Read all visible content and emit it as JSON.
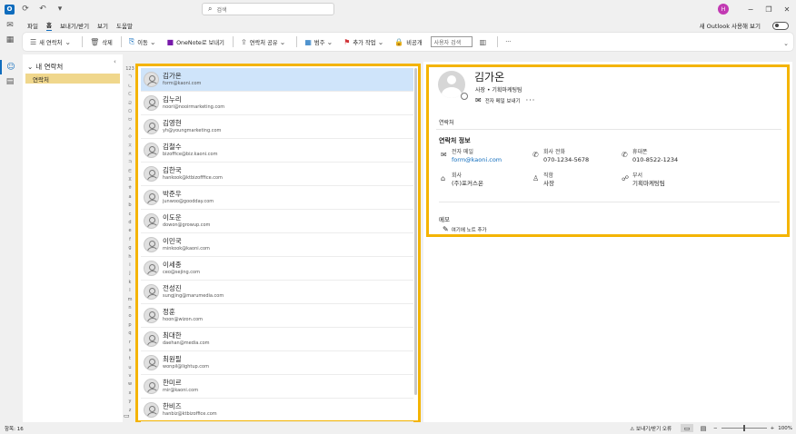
{
  "titlebar": {
    "search_placeholder": "검색",
    "avatar_initial": "H"
  },
  "menu": {
    "items": [
      "파일",
      "홈",
      "보내기/받기",
      "보기",
      "도움말"
    ],
    "active": 1,
    "new_outlook_label": "새 Outlook 사용해 보기"
  },
  "ribbon": {
    "new_contact": "새 연락처",
    "delete": "삭제",
    "move": "이동",
    "onenote": "OneNote로 보내기",
    "share_contact": "연락처 공유",
    "categorize": "범주",
    "follow_up": "추가 작업",
    "private": "비공개",
    "search_people_placeholder": "사용자 검색",
    "more": "···"
  },
  "folders": {
    "group_label": "내 연락처",
    "items": [
      "연락처"
    ]
  },
  "alphabet_index": [
    "123",
    "ㄱ",
    "ㄴ",
    "ㄷ",
    "ㄹ",
    "ㅁ",
    "ㅂ",
    "ㅅ",
    "ㅇ",
    "ㅈ",
    "ㅊ",
    "ㅋ",
    "ㅌ",
    "ㅍ",
    "ㅎ",
    "a",
    "b",
    "c",
    "d",
    "e",
    "f",
    "g",
    "h",
    "i",
    "j",
    "k",
    "l",
    "m",
    "n",
    "o",
    "p",
    "q",
    "r",
    "s",
    "t",
    "u",
    "v",
    "w",
    "x",
    "y",
    "z"
  ],
  "contacts": [
    {
      "name": "김가온",
      "email": "form@kaoni.com"
    },
    {
      "name": "김누리",
      "email": "noori@nooirmarketing.com"
    },
    {
      "name": "김영현",
      "email": "yh@youngmarketing.com"
    },
    {
      "name": "김철수",
      "email": "bizoffice@biz.kaoni.com"
    },
    {
      "name": "김한국",
      "email": "hankook@ktbizofffice.com"
    },
    {
      "name": "박준우",
      "email": "junwoo@goodday.com"
    },
    {
      "name": "이도운",
      "email": "dowon@growup.com"
    },
    {
      "name": "이민국",
      "email": "minkook@kaoni.com"
    },
    {
      "name": "이세종",
      "email": "ceo@sejing.com"
    },
    {
      "name": "전성진",
      "email": "sungjing@marumedia.com"
    },
    {
      "name": "정훈",
      "email": "hoon@wizon.com"
    },
    {
      "name": "최대한",
      "email": "daehan@media.com"
    },
    {
      "name": "최원필",
      "email": "wonpil@lightup.com"
    },
    {
      "name": "한미르",
      "email": "mir@kaoni.com"
    },
    {
      "name": "한비즈",
      "email": "hanbiz@ktbizoffice.com"
    }
  ],
  "selected_index": 0,
  "detail": {
    "name": "김가온",
    "subtitle": "사장 • 기획마케팅팀",
    "send_email": "전자 메일 보내기",
    "more": "···",
    "tab": "연락처",
    "section": "연락처 정보",
    "email_label": "전자 메일",
    "email_value": "form@kaoni.com",
    "company_phone_label": "회사 전화",
    "company_phone_value": "070-1234-5678",
    "mobile_label": "휴대폰",
    "mobile_value": "010-8522-1234",
    "company_label": "회사",
    "company_value": "(주)포커스온",
    "title_label": "직함",
    "title_value": "사장",
    "dept_label": "부서",
    "dept_value": "기획마케팅팀",
    "memo_label": "메모",
    "memo_add": "여기에 노트 추가"
  },
  "status": {
    "items_label": "항목: 16",
    "warning": "보내기/받기 오류",
    "zoom": "100%"
  },
  "colors": {
    "accent": "#0f6cbd",
    "highlight_border": "#f4b400",
    "selected_row": "#cfe4fa",
    "folder_selected": "#f0d78c"
  }
}
